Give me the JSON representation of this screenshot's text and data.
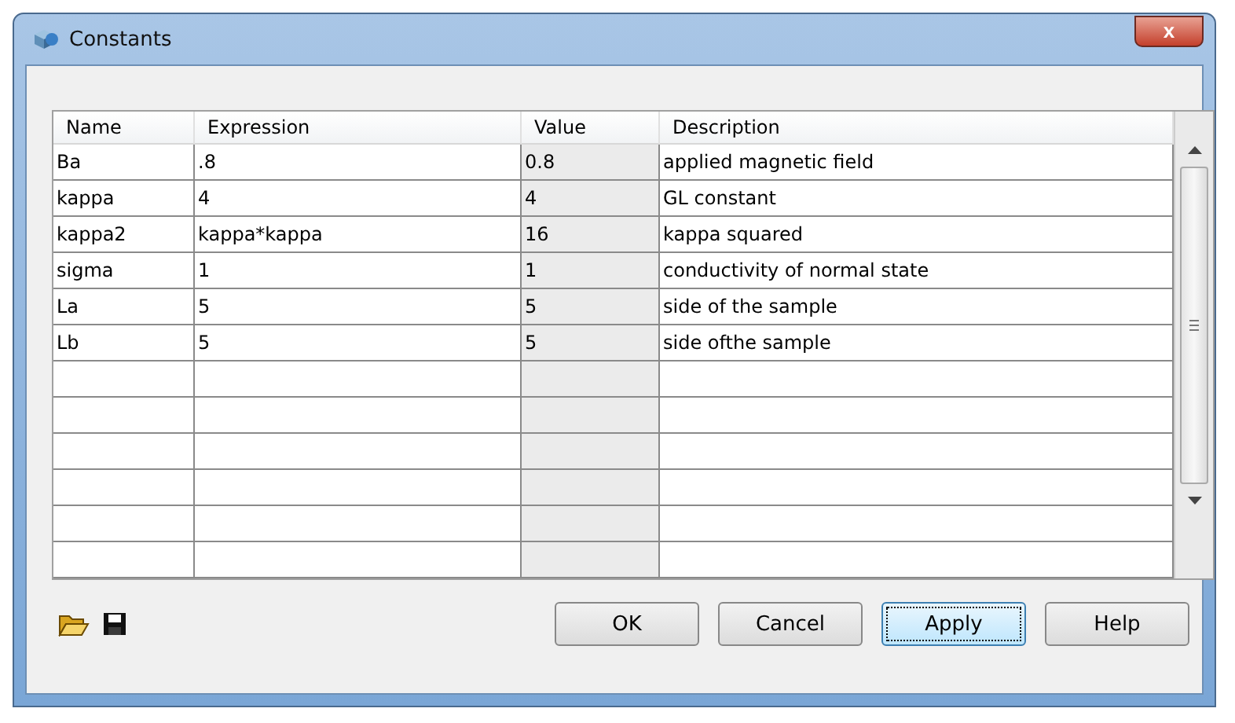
{
  "window": {
    "title": "Constants",
    "close": "x"
  },
  "table": {
    "columns": [
      "Name",
      "Expression",
      "Value",
      "Description"
    ],
    "rows": [
      [
        "Ba",
        ".8",
        "0.8",
        "applied magnetic field"
      ],
      [
        "kappa",
        "4",
        "4",
        "GL constant"
      ],
      [
        "kappa2",
        "kappa*kappa",
        "16",
        "kappa squared"
      ],
      [
        "sigma",
        "1",
        "1",
        "conductivity of normal state"
      ],
      [
        "La",
        "5",
        "5",
        "side of the sample"
      ],
      [
        "Lb",
        "5",
        "5",
        "side ofthe sample"
      ],
      [
        "",
        "",
        "",
        ""
      ],
      [
        "",
        "",
        "",
        ""
      ],
      [
        "",
        "",
        "",
        ""
      ],
      [
        "",
        "",
        "",
        ""
      ],
      [
        "",
        "",
        "",
        ""
      ],
      [
        "",
        "",
        "",
        ""
      ]
    ]
  },
  "buttons": [
    {
      "label": "OK",
      "focused": false
    },
    {
      "label": "Cancel",
      "focused": false
    },
    {
      "label": "Apply",
      "focused": true
    },
    {
      "label": "Help",
      "focused": false
    }
  ]
}
